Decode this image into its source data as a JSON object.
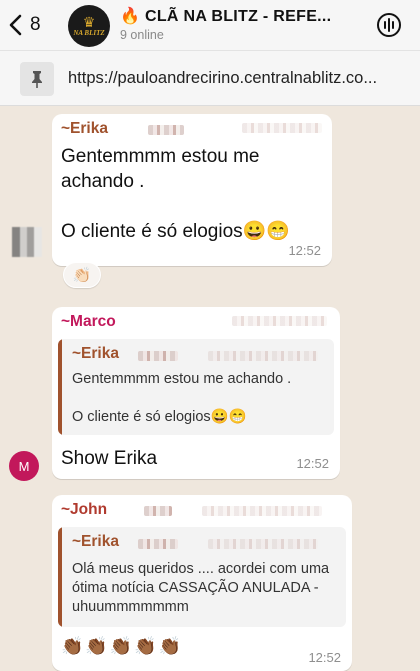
{
  "header": {
    "back_count": "8",
    "avatar_text": "NA BLITZ",
    "title": "🔥 CLÃ NA BLITZ - REFE...",
    "subtitle": "9 online"
  },
  "pinned": {
    "url": "https://pauloandrecirino.centralnablitz.co..."
  },
  "messages": [
    {
      "sender": "~Erika",
      "text": "Gentemmmm estou me\nachando .\n\nO cliente é só elogios😀😁",
      "time": "12:52",
      "reaction": "👏🏻"
    },
    {
      "sender": "~Marco",
      "quote_sender": "~Erika",
      "quote_text": "Gentemmmm estou me achando .\n\nO cliente é só elogios😀😁",
      "text": "Show Erika",
      "time": "12:52",
      "avatar_letter": "M"
    },
    {
      "sender": "~John",
      "quote_sender": "~Erika",
      "quote_text": "Olá meus queridos .... acordei com uma\nótima notícia  CASSAÇÃO ANULADA -\nuhuummmmmmm",
      "text": "👏🏾👏🏾👏🏾👏🏾👏🏾",
      "time": "12:52"
    }
  ],
  "colors": {
    "erika": "#a0522d",
    "marco": "#c2185b",
    "john": "#b03a2e",
    "background": "#efe7dd"
  }
}
